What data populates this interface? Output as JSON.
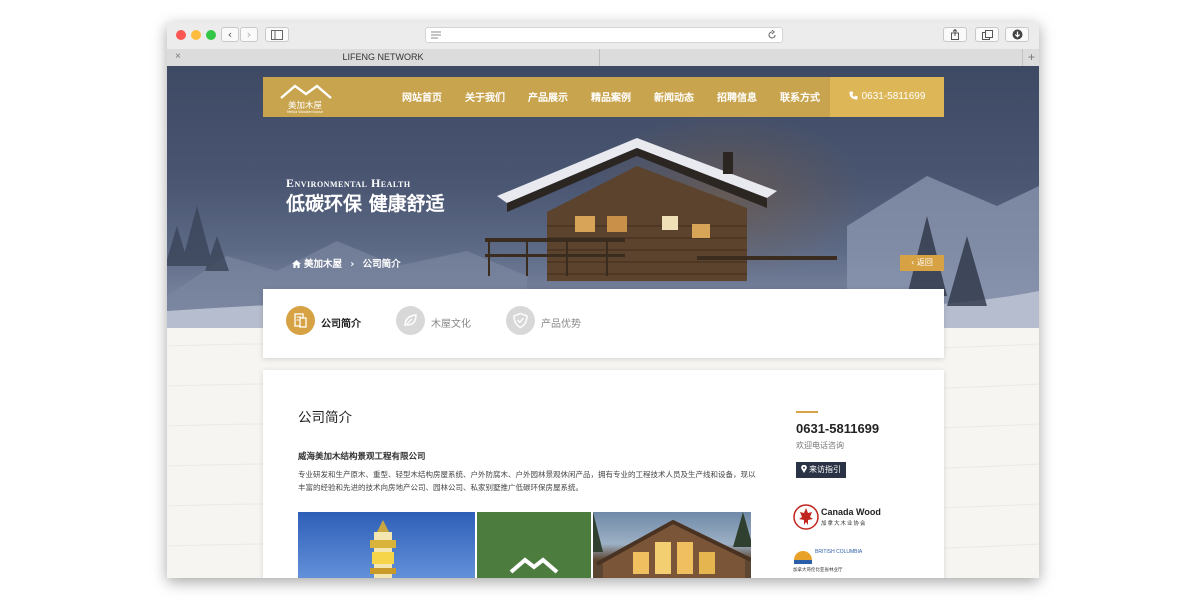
{
  "browser": {
    "tab_title": "LIFENG NETWORK",
    "traffic_colors": [
      "#fc5753",
      "#fdbc40",
      "#33c748"
    ]
  },
  "nav": {
    "logo_text": "美加木屋",
    "logo_subtext": "Meijia Woodenhouse",
    "items": [
      "网站首页",
      "关于我们",
      "产品展示",
      "精品案例",
      "新闻动态",
      "招聘信息",
      "联系方式"
    ],
    "phone": "0631-5811699"
  },
  "hero": {
    "title_en": "Environmental health",
    "title_cn": "低碳环保 健康舒适",
    "breadcrumb": [
      "美加木屋",
      "公司简介"
    ],
    "back_label": "返回"
  },
  "tabs": [
    {
      "label": "公司简介",
      "active": true,
      "icon": "document-icon"
    },
    {
      "label": "木屋文化",
      "active": false,
      "icon": "leaf-icon"
    },
    {
      "label": "产品优势",
      "active": false,
      "icon": "shield-icon"
    }
  ],
  "content": {
    "section_title": "公司简介",
    "company_name": "威海美加木结构景观工程有限公司",
    "description": "专业研发和生产原木、重型、轻型木结构房屋系统、户外防腐木、户外园林景观休闲产品，拥有专业的工程技术人员及生产线和设备，现以丰富的经验和先进的技术向房地产公司、园林公司、私家别墅推广低碳环保房屋系统。"
  },
  "sidebar": {
    "phone": "0631-5811699",
    "phone_caption": "欢迎电话咨询",
    "visit_label": "来访指引",
    "partner1_name": "Canada Wood",
    "partner1_cn": "加拿大木业协会",
    "partner2_name": "BRITISH COLUMBIA",
    "partner2_cn": "加拿大哥伦比亚省林业厅"
  },
  "colors": {
    "gold": "#c9a44e",
    "gold_light": "#ddb658",
    "navy": "#2a3346",
    "green": "#4c7d3e"
  }
}
